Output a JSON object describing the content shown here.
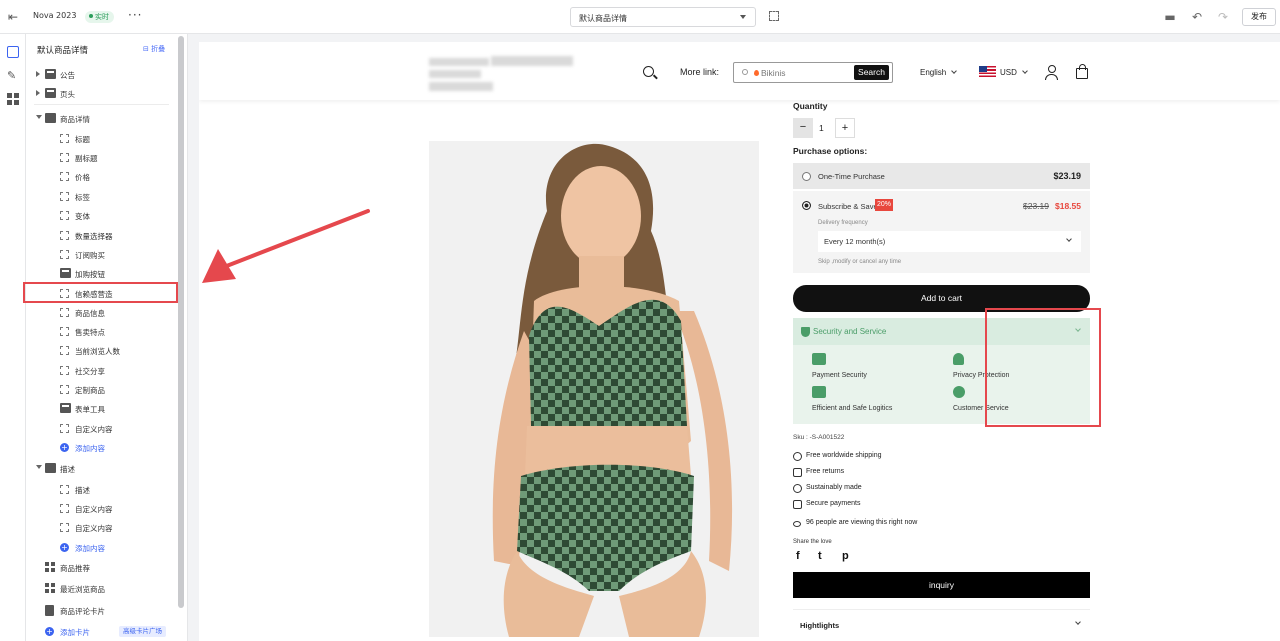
{
  "topbar": {
    "app_name": "Nova 2023",
    "status_badge": "实时",
    "page_select": "默认商品详情",
    "publish_label": "发布"
  },
  "rail": {
    "icons": [
      "layout-icon",
      "brush-icon",
      "apps-icon"
    ]
  },
  "panel": {
    "title": "默认商品详情",
    "collapse_label": "折叠",
    "tree": [
      {
        "label": "公告",
        "level": 0,
        "type": "section",
        "expand": "right"
      },
      {
        "label": "页头",
        "level": 0,
        "type": "section",
        "expand": "right"
      },
      {
        "label": "商品详情",
        "level": 0,
        "type": "card",
        "expand": "down"
      },
      {
        "label": "标题",
        "level": 1,
        "type": "block"
      },
      {
        "label": "副标题",
        "level": 1,
        "type": "block"
      },
      {
        "label": "价格",
        "level": 1,
        "type": "block"
      },
      {
        "label": "标签",
        "level": 1,
        "type": "block"
      },
      {
        "label": "变体",
        "level": 1,
        "type": "block"
      },
      {
        "label": "数量选择器",
        "level": 1,
        "type": "block"
      },
      {
        "label": "订阅购买",
        "level": 1,
        "type": "block"
      },
      {
        "label": "加购按钮",
        "level": 1,
        "type": "section"
      },
      {
        "label": "信赖感营造",
        "level": 1,
        "type": "block",
        "highlighted": true
      },
      {
        "label": "商品信息",
        "level": 1,
        "type": "block"
      },
      {
        "label": "售卖特点",
        "level": 1,
        "type": "block"
      },
      {
        "label": "当前浏览人数",
        "level": 1,
        "type": "block"
      },
      {
        "label": "社交分享",
        "level": 1,
        "type": "block"
      },
      {
        "label": "定制商品",
        "level": 1,
        "type": "block"
      },
      {
        "label": "表单工具",
        "level": 1,
        "type": "section"
      },
      {
        "label": "自定义内容",
        "level": 1,
        "type": "block"
      },
      {
        "label": "添加内容",
        "level": 1,
        "type": "add"
      },
      {
        "label": "描述",
        "level": 0,
        "type": "card",
        "expand": "down"
      },
      {
        "label": "描述",
        "level": 1,
        "type": "block"
      },
      {
        "label": "自定义内容",
        "level": 1,
        "type": "block"
      },
      {
        "label": "自定义内容",
        "level": 1,
        "type": "block"
      },
      {
        "label": "添加内容",
        "level": 1,
        "type": "add"
      },
      {
        "label": "商品推荐",
        "level": 0,
        "type": "grid"
      },
      {
        "label": "最近浏览商品",
        "level": 0,
        "type": "grid"
      },
      {
        "label": "商品评论卡片",
        "level": 0,
        "type": "doc"
      },
      {
        "label": "添加卡片",
        "level": 0,
        "type": "add",
        "tag": "高级卡片广场"
      }
    ]
  },
  "store": {
    "more_link": "More link:",
    "search_placeholder": "Bikinis",
    "search_button": "Search",
    "language": "English",
    "currency": "USD"
  },
  "product": {
    "quantity_label": "Quantity",
    "quantity_value": "1",
    "purchase_options_label": "Purchase options:",
    "one_time_label": "One-Time Purchase",
    "one_time_price": "$23.19",
    "subscribe_label": "Subscribe & Save",
    "discount_badge": "20%",
    "old_price": "$23.19",
    "new_price": "$18.55",
    "delivery_frequency_label": "Delivery frequency",
    "frequency_value": "Every 12 month(s)",
    "skip_note": "Skip ,modify or cancel any time",
    "add_to_cart": "Add to cart",
    "security_title": "Security and Service",
    "features": [
      "Payment Security",
      "Privacy Protection",
      "Efficient and Safe Logitics",
      "Customer Service"
    ],
    "sku": "Sku : -S-A001522",
    "perks": [
      "Free worldwide shipping",
      "Free returns",
      "Sustainably made",
      "Secure payments"
    ],
    "viewers": "96 people are viewing this right now",
    "share_label": "Share the love",
    "social": [
      "f",
      "t",
      "p"
    ],
    "inquiry": "inquiry",
    "highlights": "Hightlights"
  },
  "colors": {
    "accent_blue": "#3c64f0",
    "annotation_red": "#e5484d",
    "security_green": "#4a9d68",
    "discount_red": "#e8473d"
  }
}
